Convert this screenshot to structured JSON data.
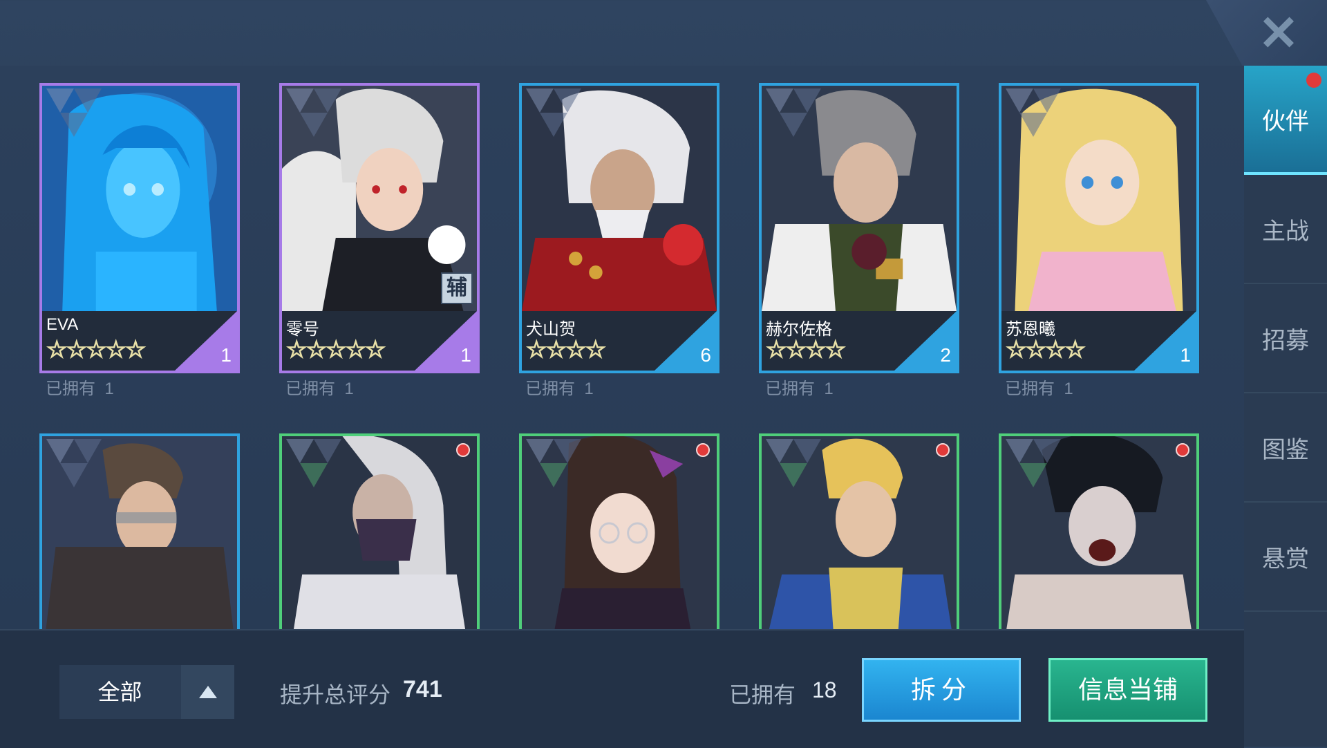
{
  "close": {
    "icon": "close-icon"
  },
  "tabs": [
    {
      "label": "伙伴",
      "active": true,
      "badge": true
    },
    {
      "label": "主战",
      "active": false
    },
    {
      "label": "招募",
      "active": false
    },
    {
      "label": "图鉴",
      "active": false
    },
    {
      "label": "悬赏",
      "active": false
    }
  ],
  "cards": [
    {
      "name": "EVA",
      "stars": "☆☆☆☆☆",
      "count": "1",
      "owned_label": "已拥有",
      "owned": "1",
      "rarity_color": "#a77be8"
    },
    {
      "name": "零号",
      "stars": "☆☆☆☆☆",
      "count": "1",
      "owned_label": "已拥有",
      "owned": "1",
      "rarity_color": "#a77be8",
      "role": "辅"
    },
    {
      "name": "犬山贺",
      "stars": "☆☆☆☆",
      "count": "6",
      "owned_label": "已拥有",
      "owned": "1",
      "rarity_color": "#2fa3e0"
    },
    {
      "name": "赫尔佐格",
      "stars": "☆☆☆☆",
      "count": "2",
      "owned_label": "已拥有",
      "owned": "1",
      "rarity_color": "#2fa3e0"
    },
    {
      "name": "苏恩曦",
      "stars": "☆☆☆☆",
      "count": "1",
      "owned_label": "已拥有",
      "owned": "1",
      "rarity_color": "#2fa3e0"
    },
    {
      "rarity_color": "#2fa3e0",
      "badge": false
    },
    {
      "rarity_color": "#4fcf7a",
      "badge": true
    },
    {
      "rarity_color": "#4fcf7a",
      "badge": true
    },
    {
      "rarity_color": "#4fcf7a",
      "badge": true
    },
    {
      "rarity_color": "#4fcf7a",
      "badge": true
    }
  ],
  "bottom": {
    "filter_label": "全部",
    "filter_icon": "triangle-up-icon",
    "score_label": "提升总评分",
    "score_value": "741",
    "total_label": "已拥有",
    "total_value": "18",
    "split_button": "拆分",
    "pawn_button": "信息当铺"
  },
  "colors": {
    "purple_rarity": "#a77be8",
    "blue_rarity": "#2fa3e0",
    "green_rarity": "#4fcf7a",
    "active_tab": "#27a4c8",
    "split_button": "#1b86d0",
    "pawn_button": "#169070",
    "notification": "#e13a3a"
  }
}
